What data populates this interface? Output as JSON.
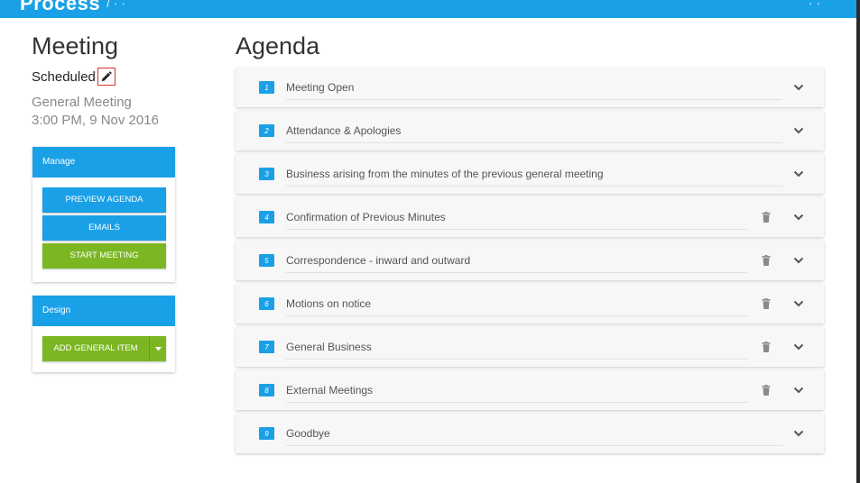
{
  "header": {
    "brand": "Process",
    "subtitle": "/ · ·",
    "right": "· ·"
  },
  "left": {
    "title": "Meeting",
    "status": "Scheduled",
    "meeting_type": "General Meeting",
    "meeting_time": "3:00 PM, 9 Nov 2016",
    "manage": {
      "heading": "Manage",
      "preview_label": "PREVIEW AGENDA",
      "emails_label": "EMAILS",
      "start_label": "START MEETING"
    },
    "design": {
      "heading": "Design",
      "add_label": "ADD GENERAL ITEM"
    }
  },
  "agenda": {
    "title": "Agenda",
    "items": [
      {
        "number": "1",
        "label": "Meeting Open",
        "deletable": false
      },
      {
        "number": "2",
        "label": "Attendance & Apologies",
        "deletable": false
      },
      {
        "number": "3",
        "label": "Business arising from the minutes of the previous general meeting",
        "deletable": false
      },
      {
        "number": "4",
        "label": "Confirmation of Previous Minutes",
        "deletable": true
      },
      {
        "number": "5",
        "label": "Correspondence - inward and outward",
        "deletable": true
      },
      {
        "number": "6",
        "label": "Motions on notice",
        "deletable": true
      },
      {
        "number": "7",
        "label": "General Business",
        "deletable": true
      },
      {
        "number": "8",
        "label": "External Meetings",
        "deletable": true
      },
      {
        "number": "9",
        "label": "Goodbye",
        "deletable": false
      }
    ]
  },
  "colors": {
    "accent_blue": "#19a0e6",
    "action_green": "#7cb723",
    "edit_highlight": "#d9302c"
  },
  "icons": {
    "edit": "pencil-icon",
    "delete": "trash-icon",
    "expand": "chevron-down-icon",
    "dropdown": "caret-down-icon"
  }
}
